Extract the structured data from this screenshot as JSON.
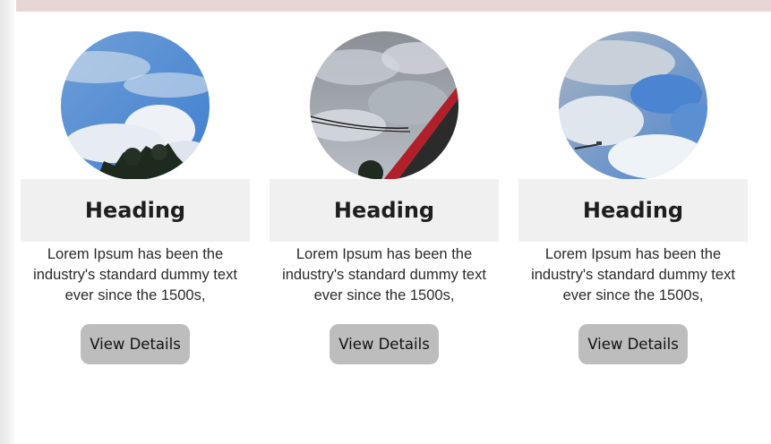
{
  "cards": [
    {
      "image_icon": "sky-photo-icon",
      "heading": "Heading",
      "description": "Lorem Ipsum has been the industry's standard dummy text ever since the 1500s,",
      "button_label": "View Details"
    },
    {
      "image_icon": "sky-photo-icon",
      "heading": "Heading",
      "description": "Lorem Ipsum has been the industry's standard dummy text ever since the 1500s,",
      "button_label": "View Details"
    },
    {
      "image_icon": "sky-photo-icon",
      "heading": "Heading",
      "description": "Lorem Ipsum has been the industry's standard dummy text ever since the 1500s,",
      "button_label": "View Details"
    }
  ],
  "colors": {
    "top_band": "#e8d6d6",
    "heading_box": "#f0f0f0",
    "button": "#bdbdbd"
  }
}
